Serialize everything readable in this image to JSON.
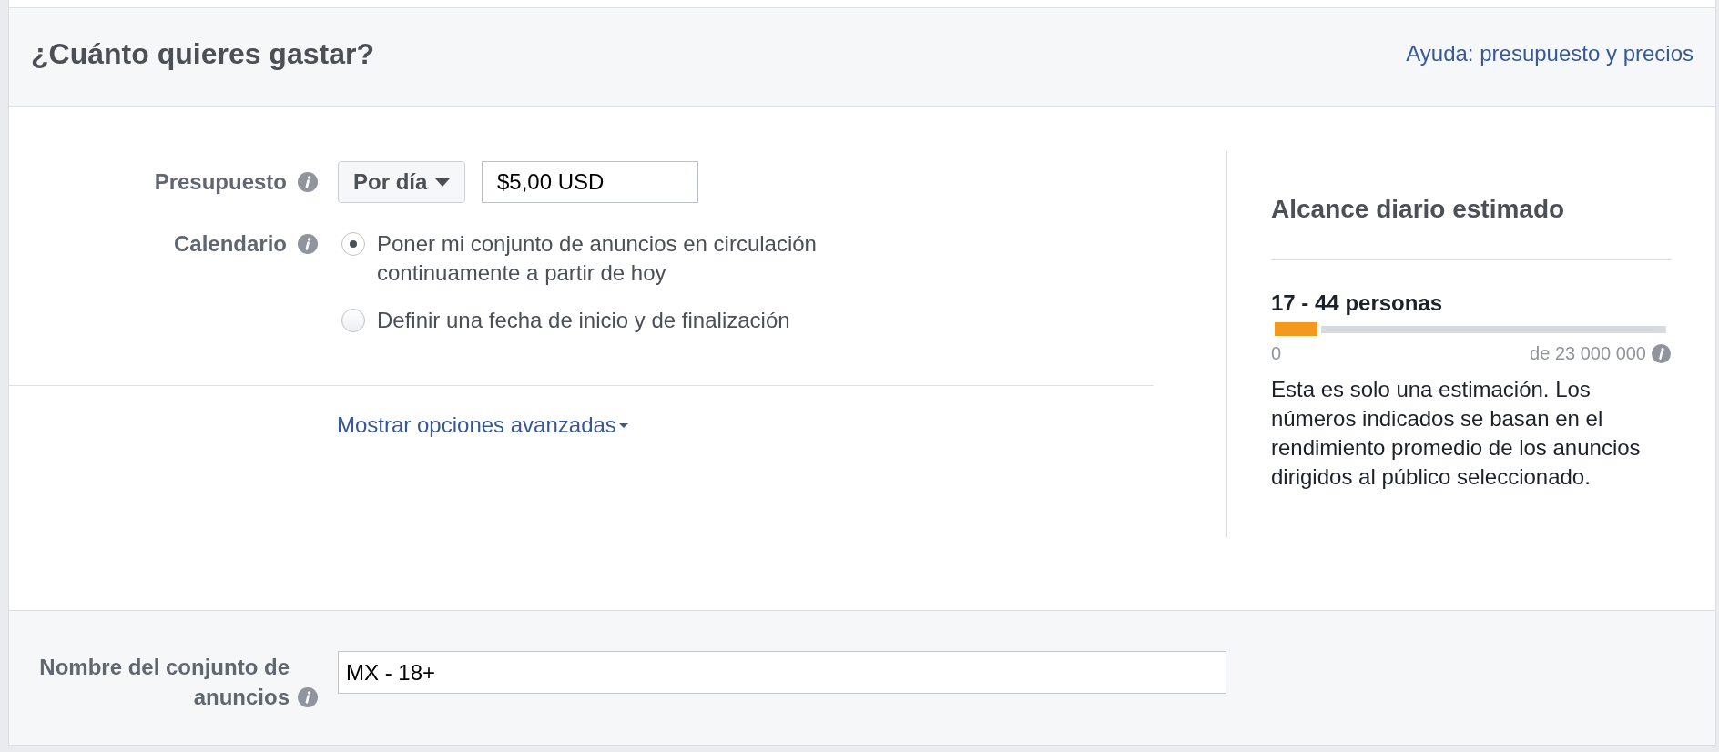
{
  "header": {
    "title": "¿Cuánto quieres gastar?",
    "help_link": "Ayuda: presupuesto y precios"
  },
  "budget": {
    "label": "Presupuesto",
    "period": "Por día",
    "amount": "$5,00 USD"
  },
  "schedule": {
    "label": "Calendario",
    "options": [
      {
        "label": "Poner mi conjunto de anuncios en circulación continuamente a partir de hoy",
        "selected": true
      },
      {
        "label": "Definir una fecha de inicio y de finalización",
        "selected": false
      }
    ]
  },
  "advanced_link": "Mostrar opciones avanzadas",
  "estimate": {
    "title": "Alcance diario estimado",
    "range": "17 - 44 personas",
    "level": 0.11,
    "min_label": "0",
    "max_label": "de 23 000 000",
    "note": "Esta es solo una estimación. Los números indicados se basan en el rendimiento promedio de los anuncios dirigidos al público seleccionado."
  },
  "ad_set_name": {
    "label": "Nombre del conjunto de anuncios",
    "value": "MX - 18+"
  }
}
